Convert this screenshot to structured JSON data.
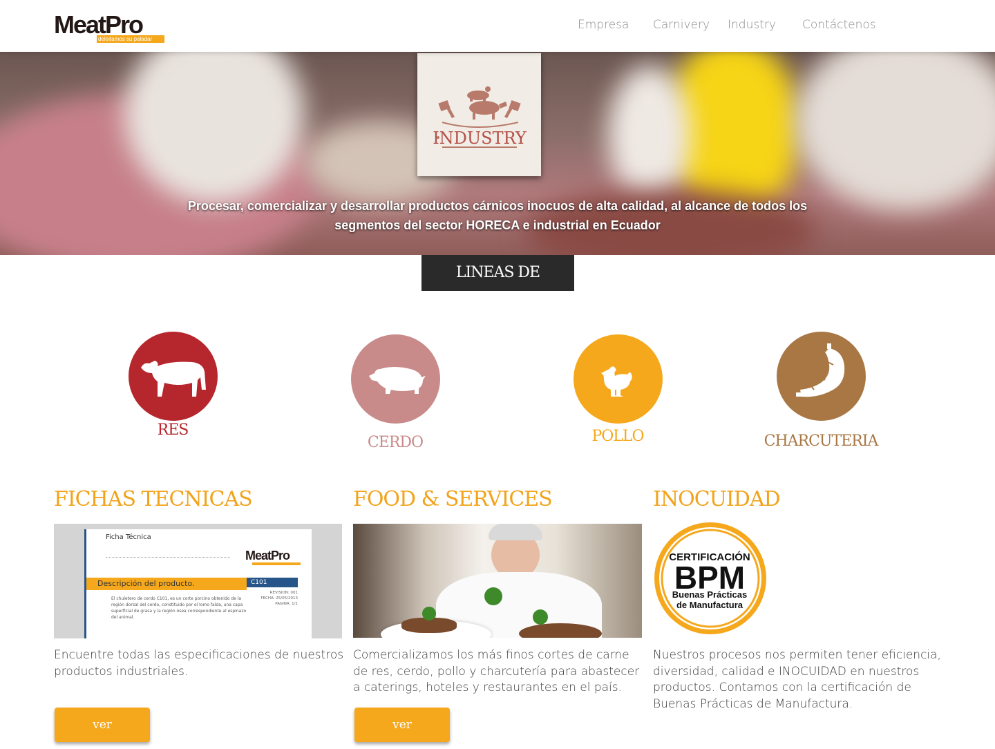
{
  "brand": {
    "name": "MeatPro",
    "tagline": "deleitamos su paladar",
    "accent": "#f5a81c"
  },
  "nav": {
    "items": [
      "Empresa",
      "Carnivery",
      "Industry",
      "Contáctenos"
    ]
  },
  "hero": {
    "badge_text": "INDUSTRY",
    "mission": "Procesar, comercializar y desarrollar productos cárnicos inocuos de alta calidad, al alcance de todos los segmentos del sector HORECA e industrial en Ecuador"
  },
  "products": {
    "title": "LINEAS DE PRODUCTOS",
    "items": [
      {
        "label": "RES",
        "color": "#b5272d",
        "icon": "cow-icon"
      },
      {
        "label": "CERDO",
        "color": "#c98a8a",
        "icon": "pig-icon"
      },
      {
        "label": "POLLO",
        "color": "#f5a81c",
        "icon": "chicken-icon"
      },
      {
        "label": "CHARCUTERIA",
        "color": "#a87744",
        "icon": "sausage-icon"
      }
    ]
  },
  "columns": {
    "fichas": {
      "title": "FICHAS TECNICAS",
      "text": "Encuentre todas las especificaciones de nuestros productos industriales.",
      "button": "ver",
      "sheet": {
        "heading": "Ficha Técnica",
        "brand": "MeatPro",
        "section": "Descripción del producto.",
        "code": "C101",
        "meta": "REVISION: 001 FECHA: 25/05/2013 PAGINA: 1/1",
        "body": "El chuletero de cerdo C101, es un corte porcino obtenido de la región dorsal del cerdo, constituido por el lomo falda, una capa superficial de grasa y la región ósea correspondiente al espinazo del animal."
      }
    },
    "food": {
      "title": "FOOD & SERVICES",
      "text": "Comercializamos los más finos cortes de carne de res, cerdo, pollo y charcutería para abastecer a caterings, hoteles y restaurantes en el país.",
      "button": "ver"
    },
    "inocuidad": {
      "title": "INOCUIDAD",
      "text": "Nuestros procesos nos permiten tener eficiencia, diversidad, calidad e INOCUIDAD en nuestros productos. Contamos con la certificación de Buenas Prácticas de Manufactura.",
      "badge": {
        "line1": "CERTIFICACIÓN",
        "line2": "BPM",
        "line3": "Buenas Prácticas",
        "line4": "de Manufactura"
      }
    }
  }
}
